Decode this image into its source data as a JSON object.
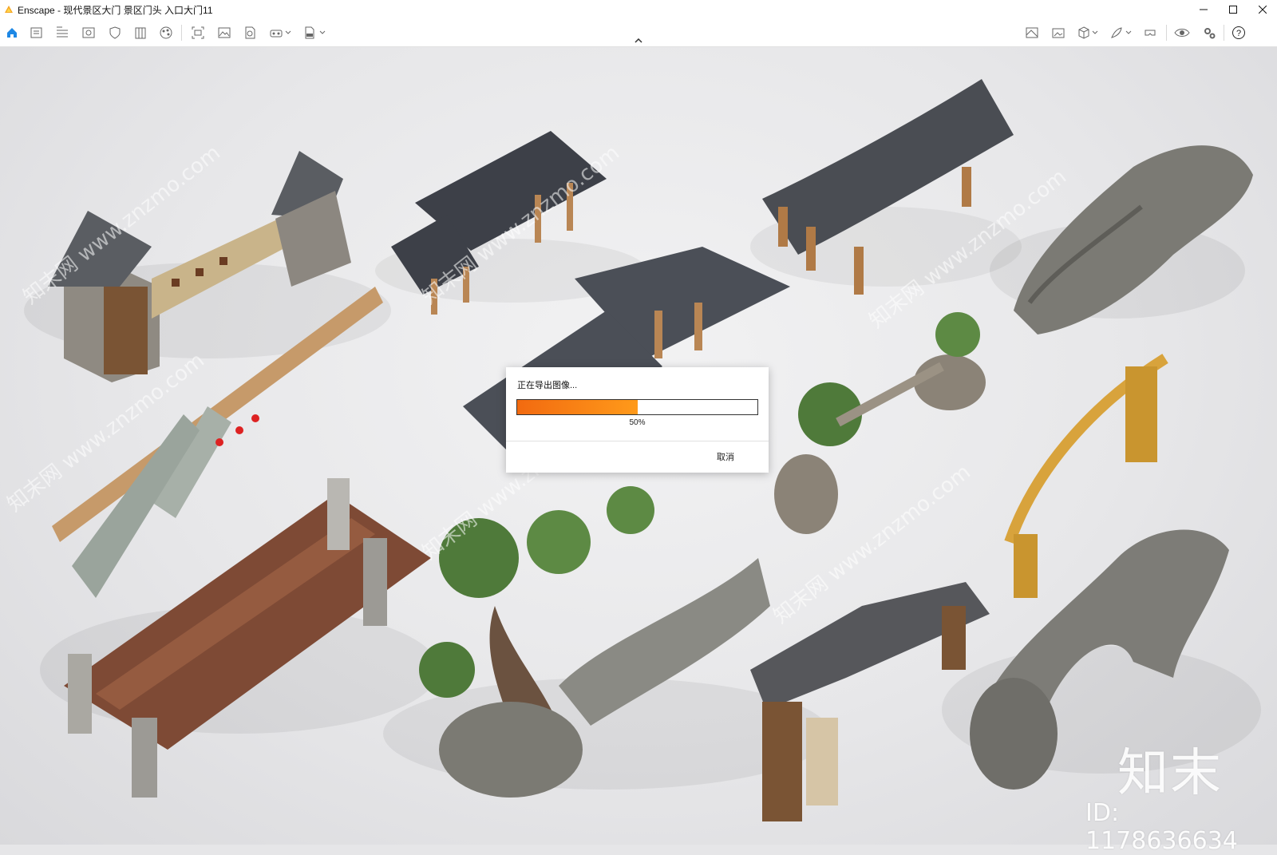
{
  "window": {
    "app_name": "Enscape",
    "title": "Enscape - 现代景区大门 景区门头 入口大门11",
    "controls": [
      "minimize-icon",
      "maximize-icon",
      "close-icon"
    ]
  },
  "toolbar": {
    "left_icons": [
      "home-icon",
      "asset-library-icon",
      "bim-icon",
      "view-icon",
      "shield-icon",
      "building-icon",
      "material-icon",
      "screenshot-icon",
      "image-icon",
      "panorama-icon",
      "vr-headset-icon",
      "export-exe-icon"
    ],
    "right_icons": [
      "map-icon",
      "gallery-icon",
      "cube-icon",
      "feather-icon",
      "vr-icon",
      "eye-icon",
      "settings-icon",
      "help-icon"
    ],
    "accent_color": "#1e88e5"
  },
  "dialog": {
    "title": "正在导出图像...",
    "progress_percent": 50,
    "progress_label": "50%",
    "cancel_label": "取消",
    "progress_color": "#f47c14"
  },
  "watermark": {
    "logo_text": "知末",
    "id_text": "ID: 1178636634",
    "diagonal_text": "知末网 www.znzmo.com"
  }
}
